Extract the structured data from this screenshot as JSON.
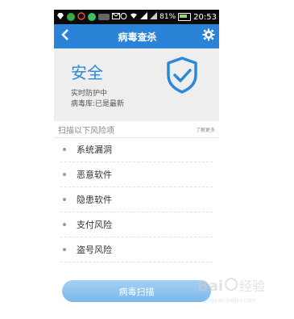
{
  "status_bar": {
    "battery": "81%",
    "time": "20:53"
  },
  "header": {
    "back_icon": "chevron-left-icon",
    "title": "病毒查杀",
    "settings_icon": "gear-icon"
  },
  "safety": {
    "status": "安全",
    "realtime": "实时防护中",
    "virus_db": "病毒库:已是最新",
    "shield_icon": "shield-check-icon"
  },
  "risks": {
    "heading": "扫描以下风险项",
    "more_label": "了解更多",
    "items": [
      {
        "label": "系统漏洞"
      },
      {
        "label": "恶意软件"
      },
      {
        "label": "隐患软件"
      },
      {
        "label": "支付风险"
      },
      {
        "label": "盗号风险"
      }
    ]
  },
  "scan_button": {
    "label": "病毒扫描"
  },
  "colors": {
    "header_blue": "#2b83d8",
    "accent_blue": "#2a8ad8",
    "button_blue": "#8cc2ee"
  }
}
